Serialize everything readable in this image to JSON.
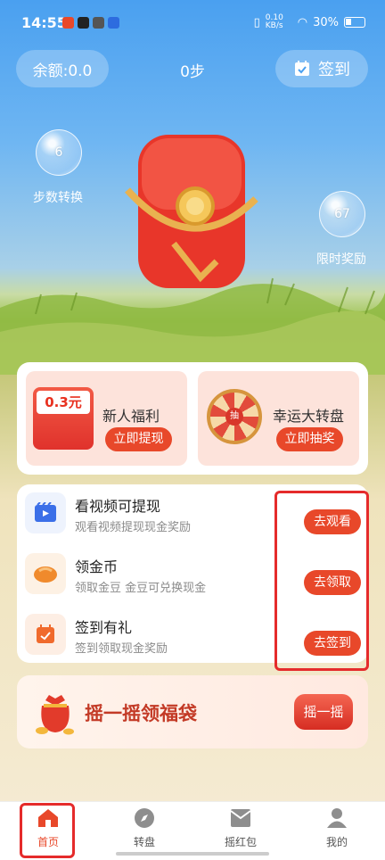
{
  "status_bar": {
    "time": "14:55",
    "net_speed": "0.10 KB/s",
    "battery": "30%"
  },
  "header": {
    "balance": "余额:0.0",
    "steps": "0步",
    "signin_label": "签到"
  },
  "bubbles": [
    {
      "value": "6",
      "label": "步数转换"
    },
    {
      "value": "67",
      "label": "限时奖励"
    }
  ],
  "cards": [
    {
      "badge": "0.3元",
      "title": "新人福利",
      "button": "立即提现"
    },
    {
      "wheel_text": "抽",
      "title": "幸运大转盘",
      "button": "立即抽奖"
    }
  ],
  "tasks": [
    {
      "icon": "video-icon",
      "title": "看视频可提现",
      "subtitle": "观看视频提现现金奖励",
      "button": "去观看"
    },
    {
      "icon": "gold-bean-icon",
      "title": "领金币",
      "subtitle": "领取金豆 金豆可兑换现金",
      "button": "去领取"
    },
    {
      "icon": "calendar-icon",
      "title": "签到有礼",
      "subtitle": "签到领取现金奖励",
      "button": "去签到"
    }
  ],
  "banner": {
    "text": "摇一摇领福袋",
    "button": "摇一摇"
  },
  "tabs": [
    {
      "label": "首页",
      "icon": "home-icon",
      "active": true
    },
    {
      "label": "转盘",
      "icon": "compass-icon",
      "active": false
    },
    {
      "label": "摇红包",
      "icon": "envelope-icon",
      "active": false
    },
    {
      "label": "我的",
      "icon": "user-icon",
      "active": false
    }
  ],
  "colors": {
    "accent": "#e8482a",
    "highlight": "#e52b2b",
    "sky": "#4aa0f0"
  }
}
